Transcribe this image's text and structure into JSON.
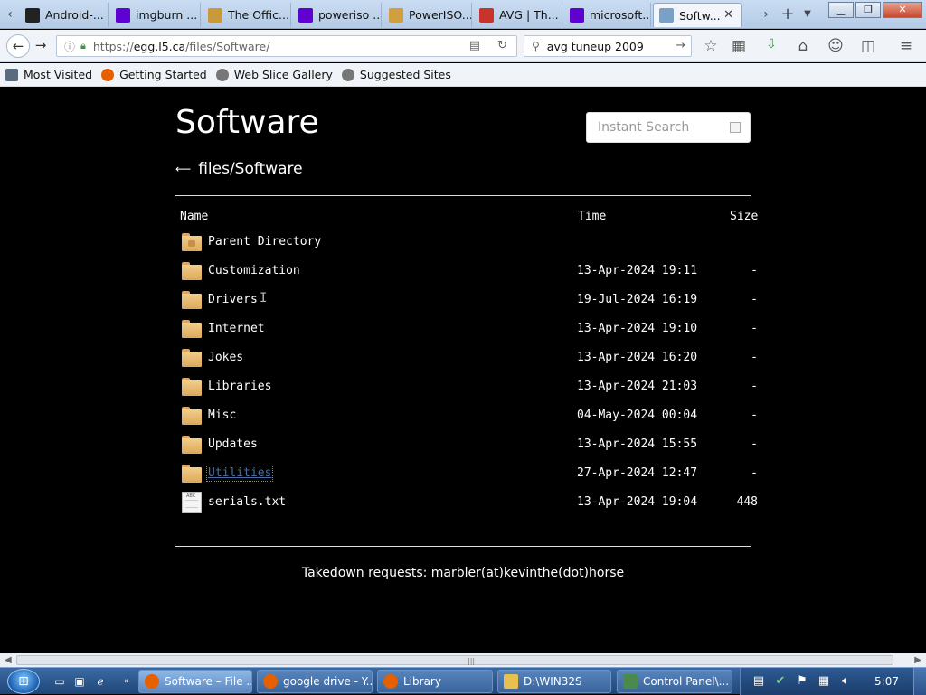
{
  "tabs": [
    {
      "label": "Android-...",
      "icon": "circle-o-icon",
      "color": "#222222"
    },
    {
      "label": "imgburn ...",
      "icon": "yahoo-icon",
      "color": "#5f01d1"
    },
    {
      "label": "The Offic...",
      "icon": "globe-icon",
      "color": "#c89a3a"
    },
    {
      "label": "poweriso ...",
      "icon": "yahoo-icon",
      "color": "#5f01d1"
    },
    {
      "label": "PowerISO...",
      "icon": "disc-icon",
      "color": "#d0a040"
    },
    {
      "label": "AVG | Th...",
      "icon": "avg-icon",
      "color": "#c8342a"
    },
    {
      "label": "microsoft...",
      "icon": "yahoo-icon",
      "color": "#5f01d1"
    },
    {
      "label": "Softw...",
      "icon": "page-icon",
      "color": "#7aa0c8"
    }
  ],
  "nav": {
    "url_prefix": "https://",
    "url_host": "egg.l5.ca",
    "url_path": "/files/Software/",
    "search_value": "avg tuneup 2009"
  },
  "bookmarks": [
    {
      "label": "Most Visited",
      "icon": "bookmark-icon",
      "color": "#5a6b80"
    },
    {
      "label": "Getting Started",
      "icon": "firefox-icon",
      "color": "#e66000"
    },
    {
      "label": "Web Slice Gallery",
      "icon": "web-slice-icon",
      "color": "#777777"
    },
    {
      "label": "Suggested Sites",
      "icon": "web-slice-icon",
      "color": "#777777"
    }
  ],
  "page": {
    "title": "Software",
    "search_placeholder": "Instant Search",
    "breadcrumb_arrow": "⟵",
    "breadcrumb": "files/Software",
    "headers": {
      "name": "Name",
      "time": "Time",
      "size": "Size"
    },
    "rows": [
      {
        "name": "Parent Directory",
        "time": "",
        "size": "",
        "kind": "parent"
      },
      {
        "name": "Customization",
        "time": "13-Apr-2024 19:11",
        "size": "-",
        "kind": "folder"
      },
      {
        "name": "Drivers",
        "time": "19-Jul-2024 16:19",
        "size": "-",
        "kind": "folder"
      },
      {
        "name": "Internet",
        "time": "13-Apr-2024 19:10",
        "size": "-",
        "kind": "folder"
      },
      {
        "name": "Jokes",
        "time": "13-Apr-2024 16:20",
        "size": "-",
        "kind": "folder"
      },
      {
        "name": "Libraries",
        "time": "13-Apr-2024 21:03",
        "size": "-",
        "kind": "folder"
      },
      {
        "name": "Misc",
        "time": "04-May-2024 00:04",
        "size": "-",
        "kind": "folder"
      },
      {
        "name": "Updates",
        "time": "13-Apr-2024 15:55",
        "size": "-",
        "kind": "folder"
      },
      {
        "name": "Utilities",
        "time": "27-Apr-2024 12:47",
        "size": "-",
        "kind": "folder",
        "focused": true
      },
      {
        "name": "serials.txt",
        "time": "13-Apr-2024 19:04",
        "size": "448",
        "kind": "file"
      }
    ],
    "footer": "Takedown requests: marbler(at)kevinthe(dot)horse"
  },
  "taskbar": {
    "tasks": [
      {
        "label": "Software – File ...",
        "icon": "firefox-icon",
        "color": "#e66000",
        "active": true
      },
      {
        "label": "google drive - Y...",
        "icon": "firefox-icon",
        "color": "#e66000"
      },
      {
        "label": "Library",
        "icon": "firefox-icon",
        "color": "#e66000"
      },
      {
        "label": "D:\\WIN32S",
        "icon": "folder-icon",
        "color": "#e8c050"
      },
      {
        "label": "Control Panel\\...",
        "icon": "control-panel-icon",
        "color": "#4a8a4a"
      }
    ],
    "clock": "5:07"
  },
  "colors": {
    "page_bg": "#000000",
    "link": "#4a6fa5",
    "rule": "#dddddd"
  }
}
